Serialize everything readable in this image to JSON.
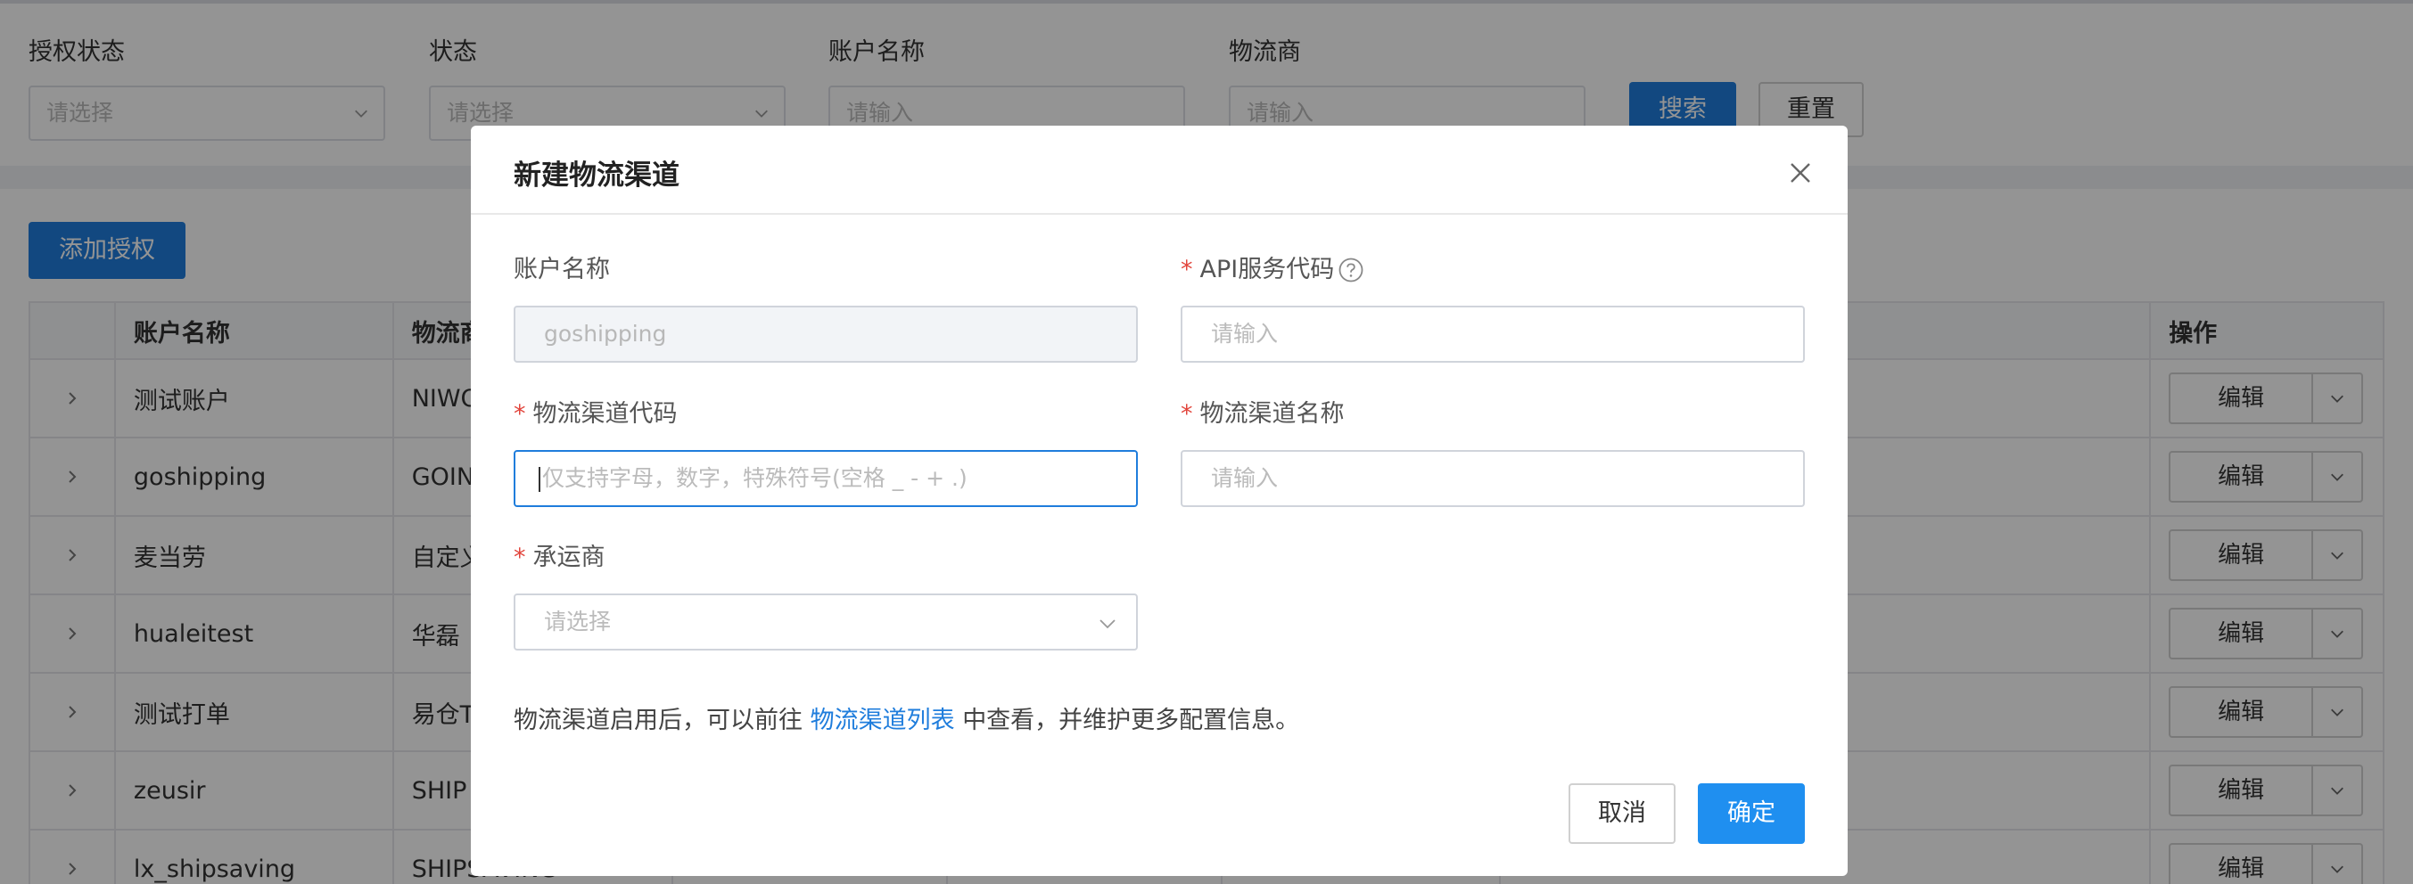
{
  "filters": [
    {
      "label": "授权状态",
      "placeholder": "请选择",
      "kind": "select"
    },
    {
      "label": "状态",
      "placeholder": "请选择",
      "kind": "select"
    },
    {
      "label": "账户名称",
      "placeholder": "请输入",
      "kind": "input"
    },
    {
      "label": "物流商",
      "placeholder": "请输入",
      "kind": "input"
    }
  ],
  "filter_buttons": {
    "search": "搜索",
    "reset": "重置"
  },
  "list": {
    "add_button": "添加授权",
    "headers": {
      "account": "账户名称",
      "logistics": "物流商",
      "actions": "操作"
    },
    "rows": [
      {
        "account": "测试账户",
        "logistics": "NIWO",
        "action": "编辑"
      },
      {
        "account": "goshipping",
        "logistics": "GOIN",
        "action": "编辑"
      },
      {
        "account": "麦当劳",
        "logistics": "自定义",
        "action": "编辑"
      },
      {
        "account": "hualeitest",
        "logistics": "华磊",
        "action": "编辑"
      },
      {
        "account": "测试打单",
        "logistics": "易仓T",
        "action": "编辑"
      },
      {
        "account": "zeusir",
        "logistics": "SHIP",
        "action": "编辑"
      },
      {
        "account": "lx_shipsaving",
        "logistics": "SHIPSAVING",
        "action": "编辑"
      }
    ]
  },
  "modal": {
    "title": "新建物流渠道",
    "fields": {
      "account_name": {
        "label": "账户名称",
        "value": "goshipping",
        "required": false
      },
      "api_code": {
        "label": "API服务代码",
        "placeholder": "请输入",
        "required": true
      },
      "channel_code": {
        "label": "物流渠道代码",
        "placeholder": "仅支持字母，数字，特殊符号(空格 _ - + .)",
        "required": true
      },
      "channel_name": {
        "label": "物流渠道名称",
        "placeholder": "请输入",
        "required": true
      },
      "carrier": {
        "label": "承运商",
        "placeholder": "请选择",
        "required": true
      }
    },
    "required_mark": "*",
    "hint_prefix": "物流渠道启用后，可以前往",
    "hint_link": "物流渠道列表",
    "hint_suffix": "中查看，并维护更多配置信息。",
    "cancel": "取消",
    "confirm": "确定"
  },
  "colors": {
    "primary": "#1f7ddc",
    "required": "#e2453c"
  },
  "icons": {
    "expand": "chevron-right-icon",
    "dropdown": "chevron-down-icon",
    "close": "close-icon",
    "help": "question-circle-icon"
  }
}
